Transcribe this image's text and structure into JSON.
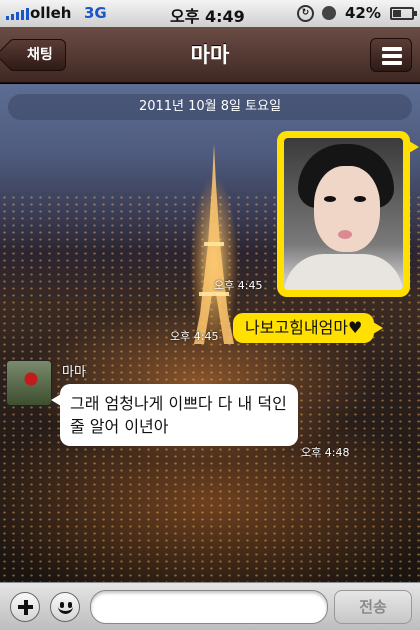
{
  "status_bar": {
    "carrier": "olleh",
    "network": "3G",
    "time": "오후 4:49",
    "battery_text": "42%",
    "battery_level": 0.42
  },
  "nav": {
    "back_label": "채팅",
    "title": "마마",
    "menu_icon": "menu-icon"
  },
  "chat": {
    "date_label": "2011년 10월 8일 토요일",
    "messages": [
      {
        "type": "photo",
        "direction": "sent",
        "time": "오후 4:45"
      },
      {
        "type": "text",
        "direction": "sent",
        "text": "나보고힘내엄마♥",
        "time": "오후 4:45"
      },
      {
        "type": "text",
        "direction": "received",
        "sender": "마마",
        "text": "그래 엄청나게 이쁘다 다 내 덕인줄 알어 이년아",
        "time": "오후 4:48"
      }
    ]
  },
  "input_bar": {
    "plus_icon": "plus-icon",
    "emoticon_icon": "smiley-icon",
    "message_value": "",
    "send_label": "전송"
  },
  "colors": {
    "sent_bubble": "#ffe000",
    "received_bubble": "#ffffff",
    "navbar": "#4f3630"
  }
}
